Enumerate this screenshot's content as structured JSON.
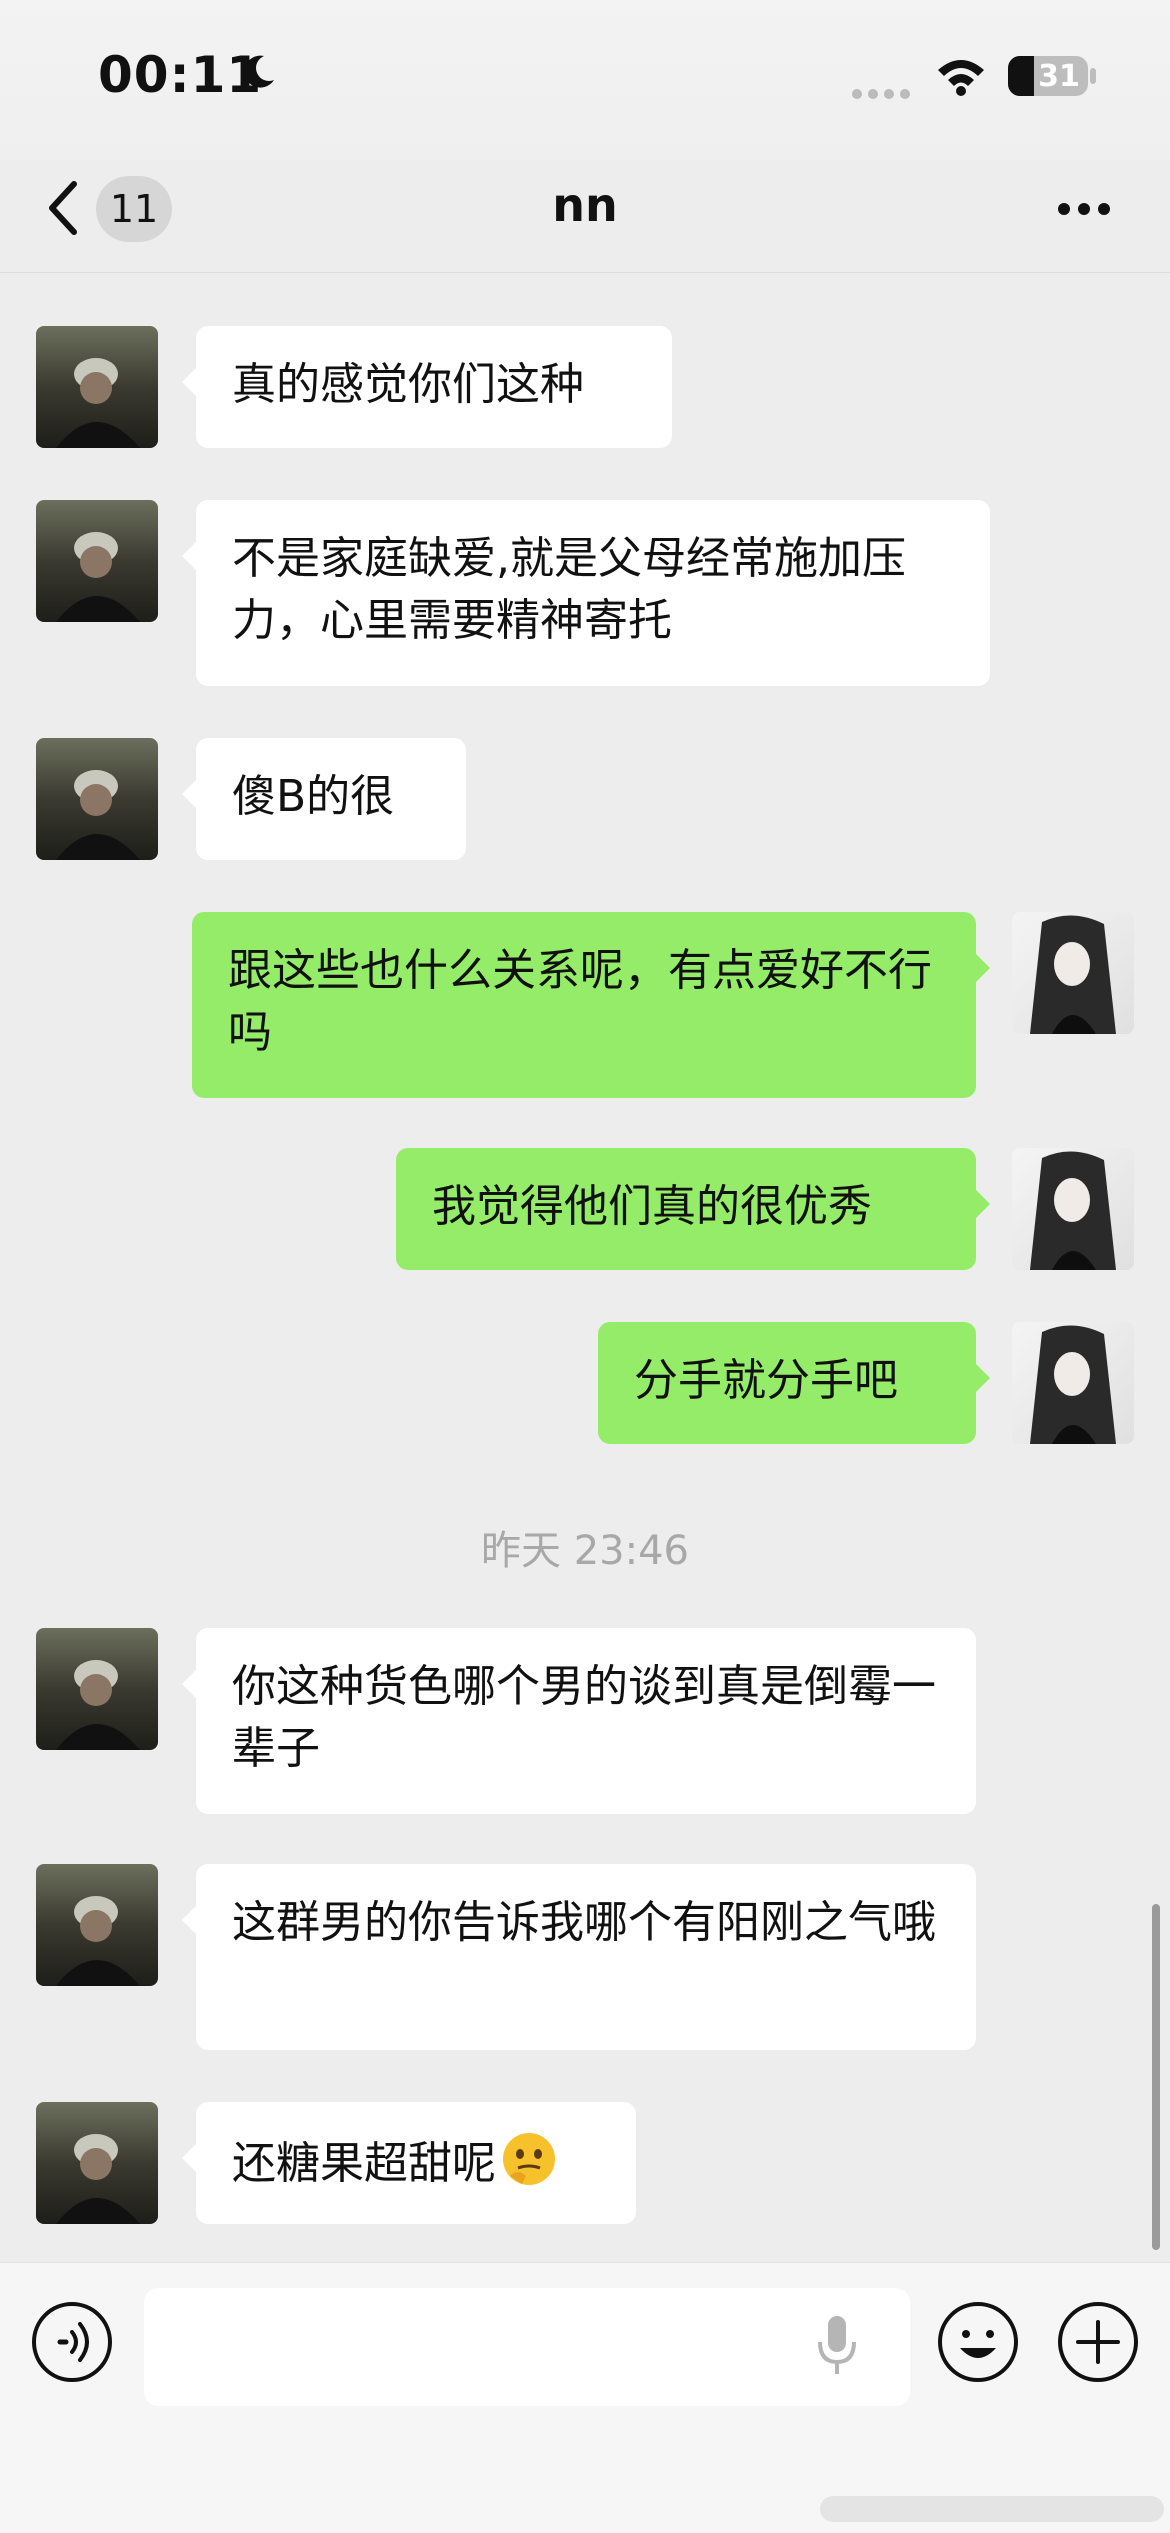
{
  "status_bar": {
    "time": "00:11",
    "battery": "31",
    "icons": [
      "moon-icon",
      "cellular-signal-icon",
      "wifi-icon",
      "battery-icon"
    ]
  },
  "nav": {
    "back_badge": "11",
    "title": "nn",
    "icons": [
      "chevron-left-icon",
      "more-icon"
    ]
  },
  "messages": [
    {
      "side": "in",
      "text": "真的感觉你们这种"
    },
    {
      "side": "in",
      "text": "不是家庭缺爱,就是父母经常施加压力，心里需要精神寄托"
    },
    {
      "side": "in",
      "text": "傻B的很"
    },
    {
      "side": "out",
      "text": "跟这些也什么关系呢，有点爱好不行吗"
    },
    {
      "side": "out",
      "text": "我觉得他们真的很优秀"
    },
    {
      "side": "out",
      "text": "分手就分手吧"
    },
    {
      "side": "in",
      "text": "你这种货色哪个男的谈到真是倒霉一辈子"
    },
    {
      "side": "in",
      "text": "这群男的你告诉我哪个有阳刚之气哦"
    },
    {
      "side": "in",
      "text": "还糖果超甜呢",
      "emoji": "thinking-face-icon"
    }
  ],
  "timestamp": "昨天 23:46",
  "input_bar": {
    "value": "",
    "icons": [
      "voice-icon",
      "microphone-icon",
      "emoji-icon",
      "plus-icon"
    ]
  },
  "colors": {
    "background": "#ededed",
    "incoming_bubble": "#ffffff",
    "outgoing_bubble": "#95ec69",
    "timestamp": "#a8a8a8"
  }
}
